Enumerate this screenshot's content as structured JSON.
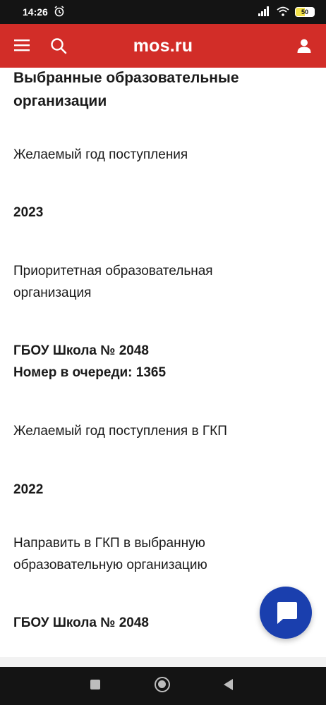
{
  "status_bar": {
    "time": "14:26",
    "battery_level": "50"
  },
  "header": {
    "brand": "mos.ru",
    "icons": [
      "menu-icon",
      "search-icon",
      "user-icon"
    ]
  },
  "content": {
    "section_title": "Выбранные образовательные организации",
    "fields": [
      {
        "label": "Желаемый год поступления",
        "value": "2023"
      },
      {
        "label": "Приоритетная образовательная организация",
        "value_line1": "ГБОУ Школа № 2048",
        "value_line2": "Номер в очереди: 1365"
      },
      {
        "label": "Желаемый год поступления в ГКП",
        "value": "2022"
      },
      {
        "label": "Направить в ГКП в выбранную образовательную организацию",
        "value": "ГБОУ Школа № 2048"
      }
    ]
  },
  "colors": {
    "header_red": "#d22d28",
    "fab_blue": "#1a3fae"
  }
}
